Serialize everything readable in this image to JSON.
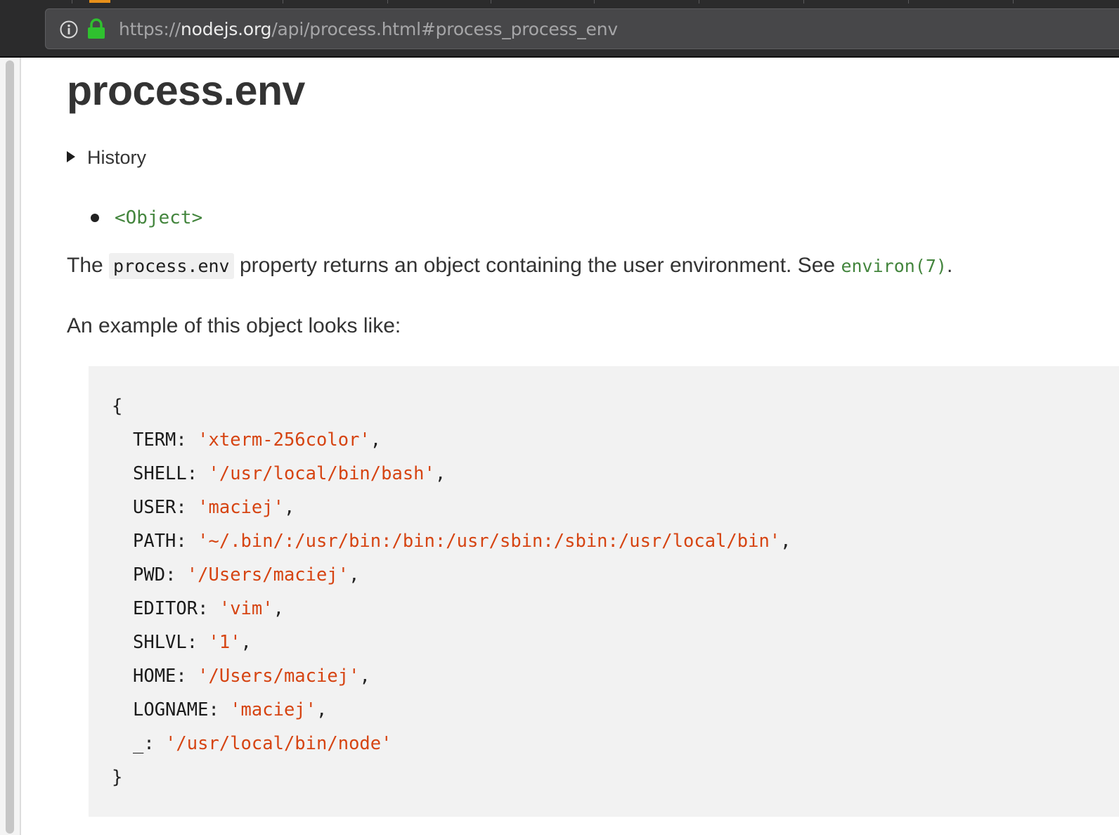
{
  "browser": {
    "url_scheme": "https://",
    "url_host": "nodejs.org",
    "url_path": "/api/process.html#process_process_env"
  },
  "page": {
    "title": "process.env",
    "history_label": "History",
    "type_label": "<Object>",
    "para1": {
      "before": "The ",
      "code": "process.env",
      "middle": " property returns an object containing the user environment. See ",
      "link": "environ(7)",
      "after": "."
    },
    "para2": "An example of this object looks like:",
    "code_open": "{",
    "code_close": "}",
    "env_entries": [
      {
        "key": "TERM",
        "value": "'xterm-256color'",
        "suffix": ","
      },
      {
        "key": "SHELL",
        "value": "'/usr/local/bin/bash'",
        "suffix": ","
      },
      {
        "key": "USER",
        "value": "'maciej'",
        "suffix": ","
      },
      {
        "key": "PATH",
        "value": "'~/.bin/:/usr/bin:/bin:/usr/sbin:/sbin:/usr/local/bin'",
        "suffix": ","
      },
      {
        "key": "PWD",
        "value": "'/Users/maciej'",
        "suffix": ","
      },
      {
        "key": "EDITOR",
        "value": "'vim'",
        "suffix": ","
      },
      {
        "key": "SHLVL",
        "value": "'1'",
        "suffix": ","
      },
      {
        "key": "HOME",
        "value": "'/Users/maciej'",
        "suffix": ","
      },
      {
        "key": "LOGNAME",
        "value": "'maciej'",
        "suffix": ","
      },
      {
        "key": "_",
        "value": "'/usr/local/bin/node'",
        "suffix": ""
      }
    ]
  },
  "colors": {
    "link_green": "#43853d",
    "string_red": "#d64412",
    "lock_green": "#2fc12f"
  },
  "icons": [
    "info-icon",
    "lock-icon",
    "triangle-right-icon",
    "bullet-icon"
  ]
}
